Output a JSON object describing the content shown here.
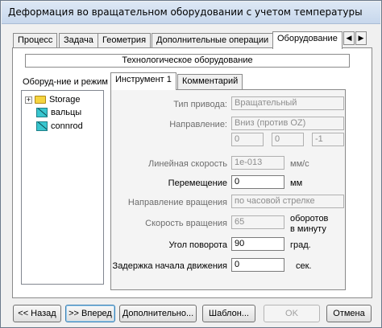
{
  "window": {
    "title": "Деформация во вращательном оборудовании с учетом температуры"
  },
  "tabs": [
    {
      "label": "Процесс"
    },
    {
      "label": "Задача"
    },
    {
      "label": "Геометрия"
    },
    {
      "label": "Дополнительные операции"
    },
    {
      "label": "Оборудование",
      "active": true
    }
  ],
  "tab_scroll": {
    "left": "◀",
    "right": "▶"
  },
  "header": "Технологическое оборудование",
  "left_pane": {
    "label": "Оборуд-ние и режим",
    "tree": [
      {
        "label": "Storage",
        "icon": "folder-icon",
        "expander": "+"
      },
      {
        "label": "вальцы",
        "icon": "tool-icon"
      },
      {
        "label": "connrod",
        "icon": "tool-icon"
      }
    ]
  },
  "inner_tabs": [
    {
      "label": "Инструмент 1",
      "active": true
    },
    {
      "label": "Комментарий"
    }
  ],
  "form": {
    "drive_type": {
      "label": "Тип привода:",
      "value": "Вращательный"
    },
    "direction": {
      "label": "Направление:",
      "value": "Вниз (против OZ)",
      "x": "0",
      "y": "0",
      "z": "-1"
    },
    "linear_speed": {
      "label": "Линейная скорость",
      "value": "1e-013",
      "unit": "мм/с"
    },
    "displacement": {
      "label": "Перемещение",
      "value": "0",
      "unit": "мм"
    },
    "rotation_direction": {
      "label": "Направление вращения",
      "value": "по часовой стрелке"
    },
    "rotation_speed": {
      "label": "Скорость вращения",
      "value": "65",
      "unit_line1": "оборотов",
      "unit_line2": "в минуту"
    },
    "rotation_angle": {
      "label": "Угол поворота",
      "value": "90",
      "unit": "град."
    },
    "start_delay": {
      "label": "Задержка начала движения",
      "value": "0",
      "unit": "сек."
    }
  },
  "buttons": {
    "back": "<< Назад",
    "next": ">> Вперед",
    "advanced": "Дополнительно...",
    "template": "Шаблон...",
    "ok": "OK",
    "cancel": "Отмена"
  }
}
